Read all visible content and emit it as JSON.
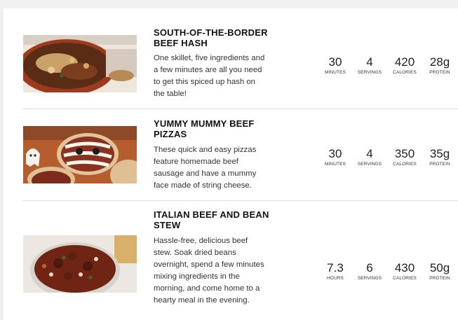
{
  "recipes": [
    {
      "title": "SOUTH-OF-THE-BORDER BEEF HASH",
      "description": "One skillet, five ingredients and a few minutes are all you need to get this spiced up hash on the table!",
      "stats": [
        {
          "value": "30",
          "label": "MINUTES"
        },
        {
          "value": "4",
          "label": "SERVINGS"
        },
        {
          "value": "420",
          "label": "CALORIES"
        },
        {
          "value": "28g",
          "label": "PROTEIN"
        }
      ]
    },
    {
      "title": "YUMMY MUMMY BEEF PIZZAS",
      "description": "These quick and easy pizzas feature homemade beef sausage and have a mummy face made of string cheese.",
      "stats": [
        {
          "value": "30",
          "label": "MINUTES"
        },
        {
          "value": "4",
          "label": "SERVINGS"
        },
        {
          "value": "350",
          "label": "CALORIES"
        },
        {
          "value": "35g",
          "label": "PROTEIN"
        }
      ]
    },
    {
      "title": "ITALIAN BEEF AND BEAN STEW",
      "description": "Hassle-free, delicious beef stew. Soak dried beans overnight, spend a few minutes mixing ingredients in the morning, and come home to a hearty meal in the evening.",
      "stats": [
        {
          "value": "7.3",
          "label": "HOURS"
        },
        {
          "value": "6",
          "label": "SERVINGS"
        },
        {
          "value": "430",
          "label": "CALORIES"
        },
        {
          "value": "50g",
          "label": "PROTEIN"
        }
      ]
    }
  ]
}
